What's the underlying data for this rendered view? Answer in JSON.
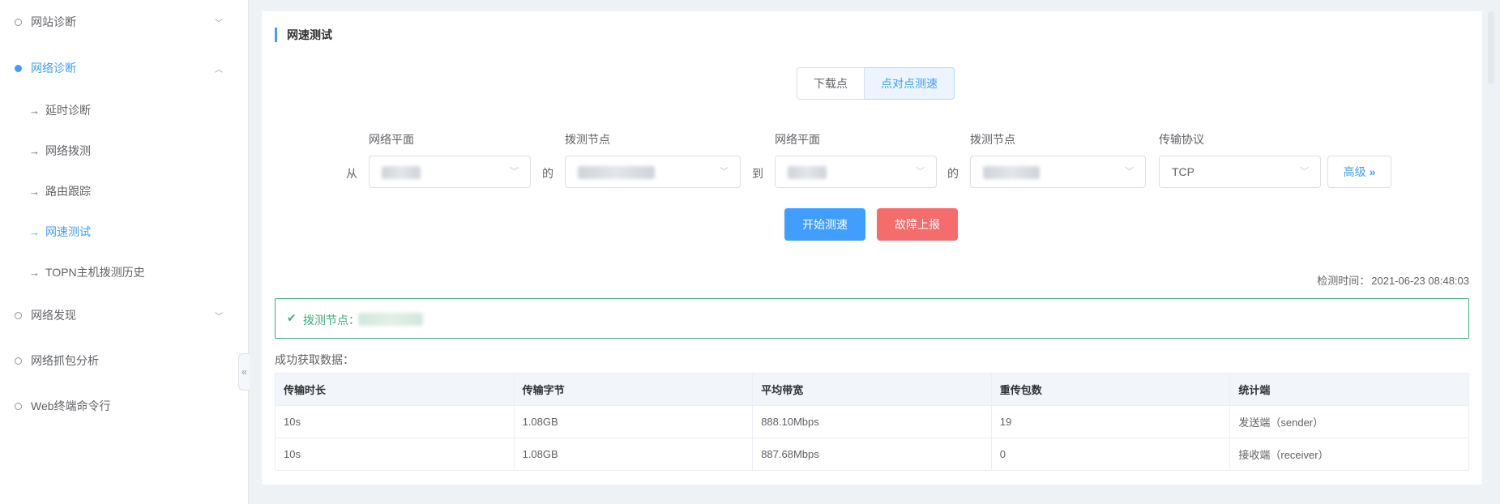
{
  "sidebar": {
    "items": [
      {
        "label": "网站诊断",
        "chevron": "﹀"
      },
      {
        "label": "网络诊断",
        "chevron": "︿"
      },
      {
        "label": "网络发现",
        "chevron": "﹀"
      },
      {
        "label": "网络抓包分析"
      },
      {
        "label": "Web终端命令行"
      }
    ],
    "sub_items": [
      {
        "label": "延时诊断"
      },
      {
        "label": "网络拨测"
      },
      {
        "label": "路由跟踪"
      },
      {
        "label": "网速测试"
      },
      {
        "label": "TOPN主机拨测历史"
      }
    ],
    "collapse_glyph": "«"
  },
  "section": {
    "title": "网速测试"
  },
  "mode": {
    "download": "下载点",
    "p2p": "点对点测速"
  },
  "form": {
    "labels": {
      "plane_from": "网络平面",
      "node_from": "拨测节点",
      "plane_to": "网络平面",
      "node_to": "拨测节点",
      "protocol": "传输协议"
    },
    "joiners": {
      "from": "从",
      "of1": "的",
      "to": "到",
      "of2": "的"
    },
    "protocol_value": "TCP",
    "advanced_label": "高级",
    "advanced_glyph": "»"
  },
  "actions": {
    "start": "开始测速",
    "report": "故障上报"
  },
  "check_time": {
    "label": "检测时间：",
    "value": "2021-06-23 08:48:03"
  },
  "result": {
    "node_label": "拨测节点："
  },
  "table": {
    "caption": "成功获取数据：",
    "headers": [
      "传输时长",
      "传输字节",
      "平均带宽",
      "重传包数",
      "统计端"
    ],
    "rows": [
      [
        "10s",
        "1.08GB",
        "888.10Mbps",
        "19",
        "发送端（sender）"
      ],
      [
        "10s",
        "1.08GB",
        "887.68Mbps",
        "0",
        "接收端（receiver）"
      ]
    ]
  },
  "colors": {
    "accent": "#409eff",
    "danger": "#f56c6c",
    "success": "#3bb07a"
  }
}
